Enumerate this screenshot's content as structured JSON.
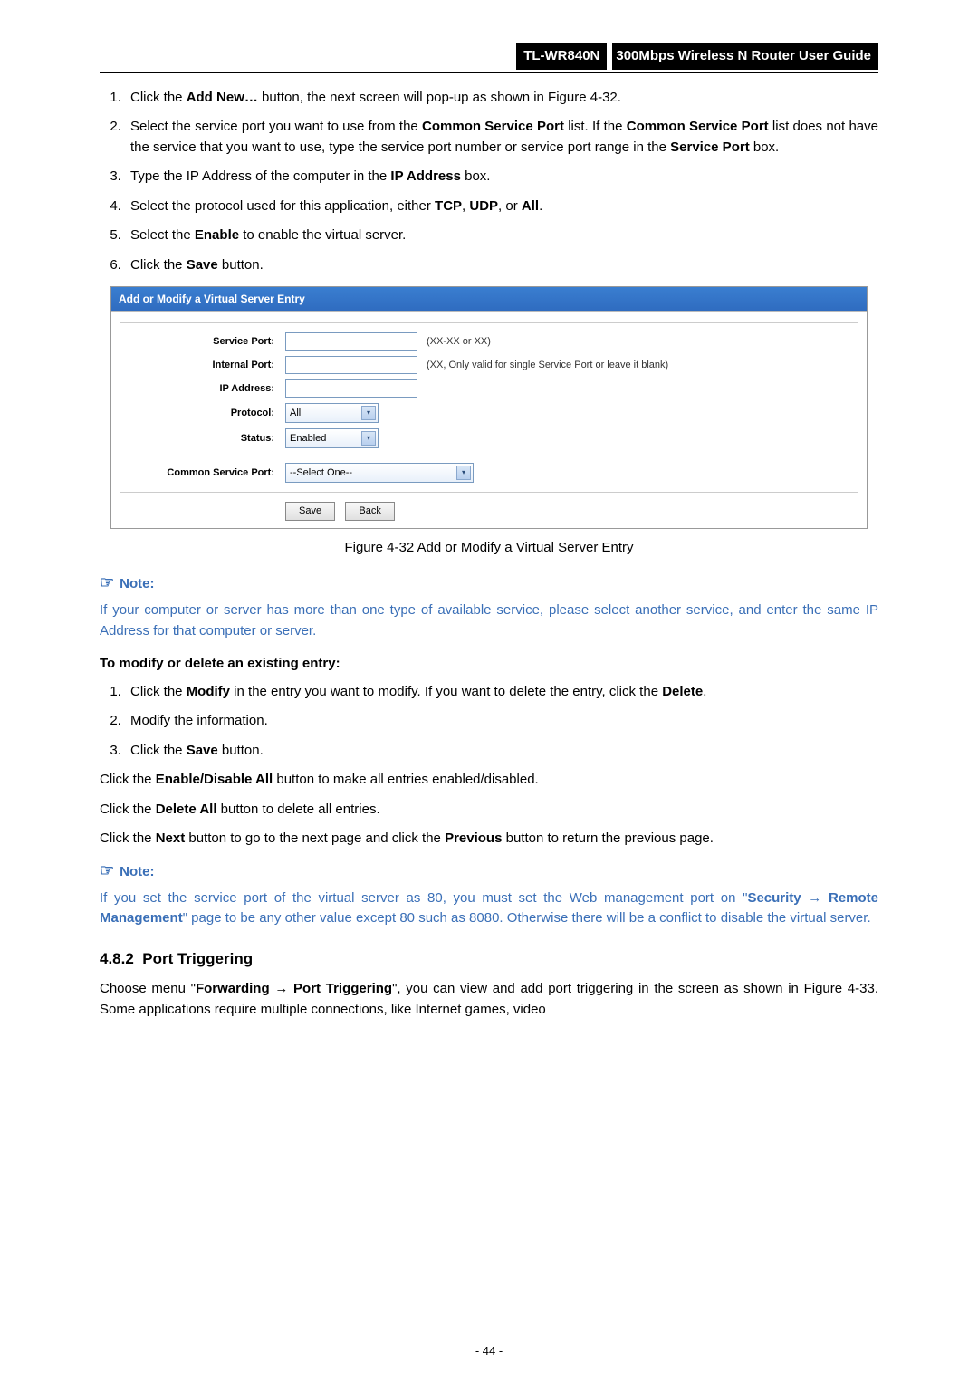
{
  "header": {
    "model": "TL-WR840N",
    "title": "300Mbps Wireless N Router User Guide"
  },
  "steps_a": {
    "s1_a": "Click the ",
    "s1_b": "Add New…",
    "s1_c": " button, the next screen will pop-up as shown in Figure 4-32.",
    "s2_a": "Select the service port you want to use from the ",
    "s2_b": "Common Service Port",
    "s2_c": " list. If the ",
    "s2_d": "Common Service Port",
    "s2_e": " list does not have the service that you want to use, type the service port number or service port range in the ",
    "s2_f": "Service Port",
    "s2_g": " box.",
    "s3_a": "Type the IP Address of the computer in the ",
    "s3_b": "IP Address",
    "s3_c": " box.",
    "s4_a": "Select the protocol used for this application, either ",
    "s4_b": "TCP",
    "s4_c": ", ",
    "s4_d": "UDP",
    "s4_e": ", or ",
    "s4_f": "All",
    "s4_g": ".",
    "s5_a": "Select the ",
    "s5_b": "Enable",
    "s5_c": " to enable the virtual server.",
    "s6_a": "Click the ",
    "s6_b": "Save",
    "s6_c": " button."
  },
  "figure": {
    "header": "Add or Modify a Virtual Server Entry",
    "labels": {
      "service_port": "Service Port:",
      "internal_port": "Internal Port:",
      "ip_address": "IP Address:",
      "protocol": "Protocol:",
      "status": "Status:",
      "common_port": "Common Service Port:"
    },
    "values": {
      "protocol": "All",
      "status": "Enabled",
      "common_port": "--Select One--"
    },
    "hints": {
      "service_port": "(XX-XX or XX)",
      "internal_port": "(XX, Only valid for single Service Port or leave it blank)"
    },
    "buttons": {
      "save": "Save",
      "back": "Back"
    }
  },
  "caption": "Figure 4-32    Add or Modify a Virtual Server Entry",
  "note1": {
    "label": "Note:",
    "body": "If your computer or server has more than one type of available service, please select another service, and enter the same IP Address for that computer or server."
  },
  "subhead1": "To modify or delete an existing entry:",
  "steps_b": {
    "s1_a": "Click the ",
    "s1_b": "Modify",
    "s1_c": " in the entry you want to modify. If you want to delete the entry, click the ",
    "s1_d": "Delete",
    "s1_e": ".",
    "s2": "Modify the information.",
    "s3_a": "Click the ",
    "s3_b": "Save",
    "s3_c": " button."
  },
  "para1_a": "Click the ",
  "para1_b": "Enable/Disable All",
  "para1_c": " button to make all entries enabled/disabled.",
  "para2_a": "Click the ",
  "para2_b": "Delete All",
  "para2_c": " button to delete all entries.",
  "para3_a": "Click the ",
  "para3_b": "Next",
  "para3_c": " button to go to the next page and click the ",
  "para3_d": "Previous",
  "para3_e": " button to return the previous page.",
  "note2": {
    "label": "Note:",
    "body_a": "If you set the service port of the virtual server as 80, you must set the Web management port on \"",
    "body_b": "Security",
    "body_arrow": " → ",
    "body_c": "Remote Management",
    "body_d": "\" page to be any other value except 80 such as 8080. Otherwise there will be a conflict to disable the virtual server."
  },
  "section": {
    "num": "4.8.2",
    "title": "Port Triggering"
  },
  "section_para_a": "Choose menu \"",
  "section_para_b": "Forwarding",
  "section_para_arrow": " → ",
  "section_para_c": "Port Triggering",
  "section_para_d": "\", you can view and add port triggering in the screen as shown in Figure 4-33. Some applications require multiple connections, like Internet games, video",
  "pagenum": "- 44 -"
}
